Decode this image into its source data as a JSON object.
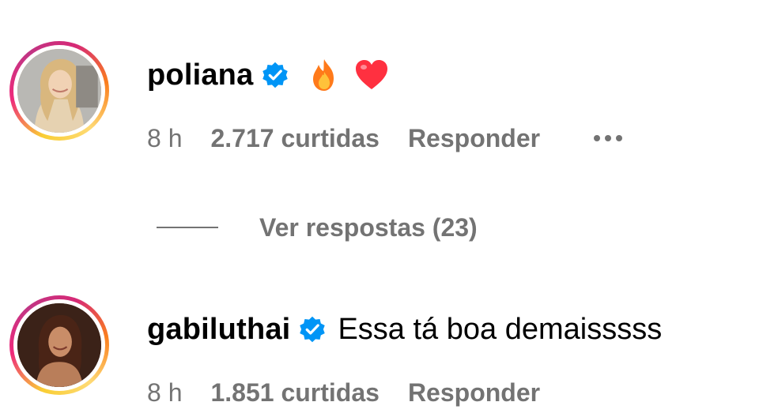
{
  "comments": [
    {
      "username": "poliana",
      "verified": true,
      "text": "",
      "emojis": [
        "fire-emoji",
        "heart-emoji"
      ],
      "time": "8 h",
      "likes": "2.717 curtidas",
      "reply_label": "Responder",
      "more_icon": "more-icon"
    },
    {
      "username": "gabiluthai",
      "verified": true,
      "text": "Essa tá boa demaisssss",
      "time": "8 h",
      "likes": "1.851 curtidas",
      "reply_label": "Responder"
    }
  ],
  "view_replies": "Ver respostas (23)",
  "colors": {
    "verified_blue": "#0095f6",
    "secondary_text": "#737373",
    "heart": "#ff3040",
    "fire": "#ff9a1f"
  }
}
